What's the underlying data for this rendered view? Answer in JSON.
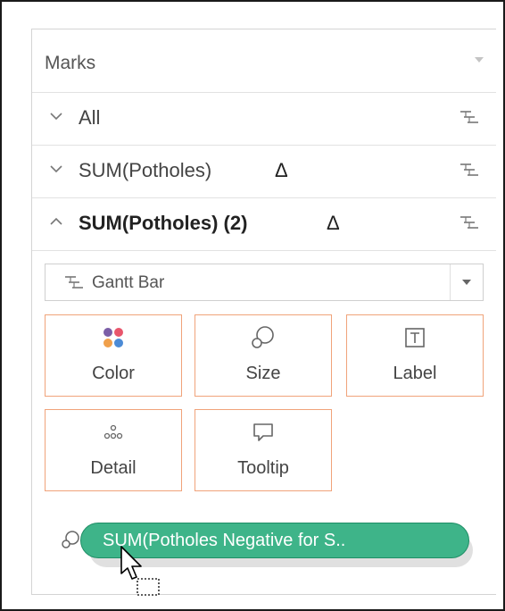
{
  "marks": {
    "title": "Marks",
    "rows": [
      {
        "label": "All",
        "expanded": false,
        "bold": false,
        "delta": ""
      },
      {
        "label": "SUM(Potholes)",
        "expanded": false,
        "bold": false,
        "delta": "Δ"
      },
      {
        "label": "SUM(Potholes) (2)",
        "expanded": true,
        "bold": true,
        "delta": "Δ"
      }
    ],
    "mark_type": {
      "selected": "Gantt Bar",
      "icon": "gantt-bar-icon"
    },
    "cards": [
      {
        "label": "Color",
        "icon": "color-icon"
      },
      {
        "label": "Size",
        "icon": "size-icon"
      },
      {
        "label": "Label",
        "icon": "label-icon"
      },
      {
        "label": "Detail",
        "icon": "detail-icon"
      },
      {
        "label": "Tooltip",
        "icon": "tooltip-icon"
      }
    ],
    "pill": {
      "text": "SUM(Potholes Negative for S..",
      "icon": "size-icon"
    }
  },
  "colors": {
    "card_border": "#f0a37a",
    "pill_fill": "#3eb489",
    "pill_border": "#1f8e66",
    "color_dots": [
      "#7b5ea7",
      "#e8566c",
      "#f0a04b",
      "#4c8bd6"
    ]
  }
}
